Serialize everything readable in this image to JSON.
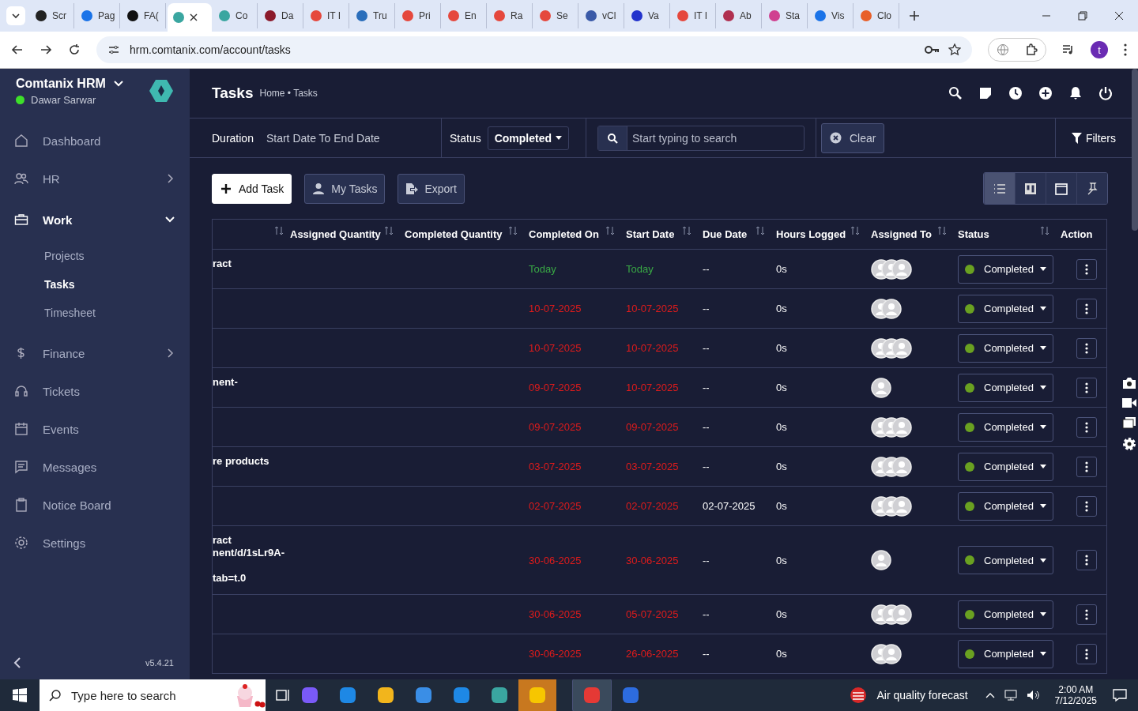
{
  "browser": {
    "tabs": [
      {
        "label": "Scr",
        "selected": false
      },
      {
        "label": "Pag",
        "selected": false
      },
      {
        "label": "FA(",
        "selected": false
      },
      {
        "selected": true
      },
      {
        "label": "Co",
        "selected": false
      },
      {
        "label": "Da",
        "selected": false
      },
      {
        "label": "IT I",
        "selected": false
      },
      {
        "label": "Tru",
        "selected": false
      },
      {
        "label": "Pri",
        "selected": false
      },
      {
        "label": "En",
        "selected": false
      },
      {
        "label": "Ra",
        "selected": false
      },
      {
        "label": "Se",
        "selected": false
      },
      {
        "label": "vCl",
        "selected": false
      },
      {
        "label": "Va",
        "selected": false
      },
      {
        "label": "IT I",
        "selected": false
      },
      {
        "label": "Ab",
        "selected": false
      },
      {
        "label": "Sta",
        "selected": false
      },
      {
        "label": "Vis",
        "selected": false
      },
      {
        "label": "Clo",
        "selected": false
      }
    ],
    "url": "hrm.comtanix.com/account/tasks",
    "profile_initial": "t"
  },
  "sidebar": {
    "company": "Comtanix HRM",
    "user": "Dawar Sarwar",
    "online": true,
    "items": [
      {
        "label": "Dashboard",
        "selected": false
      },
      {
        "label": "HR",
        "expanded": false,
        "selected": false
      },
      {
        "label": "Work",
        "expanded": true,
        "selected": true,
        "children": [
          {
            "label": "Projects",
            "selected": false
          },
          {
            "label": "Tasks",
            "selected": true
          },
          {
            "label": "Timesheet",
            "selected": false
          }
        ]
      },
      {
        "label": "Finance",
        "expanded": false,
        "selected": false
      },
      {
        "label": "Tickets",
        "selected": false
      },
      {
        "label": "Events",
        "selected": false
      },
      {
        "label": "Messages",
        "selected": false
      },
      {
        "label": "Notice Board",
        "selected": false
      },
      {
        "label": "Settings",
        "selected": false
      }
    ],
    "version": "v5.4.21"
  },
  "header": {
    "title": "Tasks",
    "breadcrumb": "Home • Tasks"
  },
  "filters": {
    "duration_label": "Duration",
    "duration_value": "Start Date To End Date",
    "status_label": "Status",
    "status_value": "Completed",
    "search_placeholder": "Start typing to search",
    "clear": "Clear",
    "filters": "Filters"
  },
  "toolbar": {
    "buttons": [
      "Add Task",
      "My Tasks",
      "Export"
    ],
    "views": [
      {
        "selected": true
      },
      {
        "selected": false
      },
      {
        "selected": false
      },
      {
        "selected": false
      }
    ]
  },
  "table": {
    "columns": [
      {
        "sortable": true
      },
      {
        "label": "Assigned Quantity",
        "sortable": true
      },
      {
        "label": "Completed Quantity",
        "sortable": true
      },
      {
        "label": "Completed On",
        "sortable": true
      },
      {
        "label": "Start Date",
        "sortable": true
      },
      {
        "label": "Due Date",
        "sortable": true
      },
      {
        "label": "Hours Logged",
        "sortable": true
      },
      {
        "label": "Assigned To",
        "sortable": true
      },
      {
        "label": "Status",
        "sortable": true
      },
      {
        "label": "Action",
        "sortable": false
      }
    ],
    "rows": [
      {
        "task": "ract",
        "completed_on": {
          "text": "Today",
          "overdue": false
        },
        "start_date": {
          "text": "Today",
          "overdue": false
        },
        "due_date": "--",
        "hours": "0s",
        "assignees": [
          {
            "kind": "avatar"
          },
          {
            "kind": "avatar"
          },
          {
            "kind": "avatar"
          }
        ],
        "status": "Completed"
      },
      {
        "completed_on": {
          "text": "10-07-2025",
          "overdue": true
        },
        "start_date": {
          "text": "10-07-2025",
          "overdue": true
        },
        "due_date": "--",
        "hours": "0s",
        "assignees": [
          {
            "kind": "avatar"
          },
          {
            "kind": "avatar"
          }
        ],
        "status": "Completed"
      },
      {
        "completed_on": {
          "text": "10-07-2025",
          "overdue": true
        },
        "start_date": {
          "text": "10-07-2025",
          "overdue": true
        },
        "due_date": "--",
        "hours": "0s",
        "assignees": [
          {
            "kind": "avatar"
          },
          {
            "kind": "avatar"
          },
          {
            "kind": "avatar"
          }
        ],
        "status": "Completed"
      },
      {
        "task": "nent-",
        "completed_on": {
          "text": "09-07-2025",
          "overdue": true
        },
        "start_date": {
          "text": "10-07-2025",
          "overdue": true
        },
        "due_date": "--",
        "hours": "0s",
        "assignees": [
          {
            "kind": "avatar"
          }
        ],
        "status": "Completed"
      },
      {
        "completed_on": {
          "text": "09-07-2025",
          "overdue": true
        },
        "start_date": {
          "text": "09-07-2025",
          "overdue": true
        },
        "due_date": "--",
        "hours": "0s",
        "assignees": [
          {
            "kind": "avatar"
          },
          {
            "kind": "avatar"
          },
          {
            "kind": "avatar"
          }
        ],
        "status": "Completed"
      },
      {
        "task": "re products",
        "completed_on": {
          "text": "03-07-2025",
          "overdue": true
        },
        "start_date": {
          "text": "03-07-2025",
          "overdue": true
        },
        "due_date": "--",
        "hours": "0s",
        "assignees": [
          {
            "kind": "avatar"
          },
          {
            "kind": "avatar"
          },
          {
            "kind": "avatar"
          }
        ],
        "status": "Completed"
      },
      {
        "completed_on": {
          "text": "02-07-2025",
          "overdue": true
        },
        "start_date": {
          "text": "02-07-2025",
          "overdue": true
        },
        "due_date": "02-07-2025",
        "hours": "0s",
        "assignees": [
          {
            "kind": "avatar"
          },
          {
            "kind": "avatar"
          },
          {
            "kind": "avatar"
          }
        ],
        "status": "Completed"
      },
      {
        "task": "ract\nnent/d/1sLr9A-\n\ntab=t.0",
        "completed_on": {
          "text": "30-06-2025",
          "overdue": true
        },
        "start_date": {
          "text": "30-06-2025",
          "overdue": true
        },
        "due_date": "--",
        "hours": "0s",
        "assignees": [
          {
            "kind": "avatar"
          }
        ],
        "status": "Completed"
      },
      {
        "completed_on": {
          "text": "30-06-2025",
          "overdue": true
        },
        "start_date": {
          "text": "05-07-2025",
          "overdue": true
        },
        "due_date": "--",
        "hours": "0s",
        "assignees": [
          {
            "kind": "avatar"
          },
          {
            "kind": "avatar"
          },
          {
            "kind": "avatar"
          }
        ],
        "status": "Completed"
      },
      {
        "completed_on": {
          "text": "30-06-2025",
          "overdue": true
        },
        "start_date": {
          "text": "26-06-2025",
          "overdue": true
        },
        "due_date": "--",
        "hours": "0s",
        "assignees": [
          {
            "kind": "avatar"
          },
          {
            "kind": "avatar"
          }
        ],
        "status": "Completed"
      }
    ]
  },
  "taskbar": {
    "search_placeholder": "Type here to search",
    "weather": "Air quality forecast",
    "time": "2:00 AM",
    "date": "7/12/2025"
  }
}
